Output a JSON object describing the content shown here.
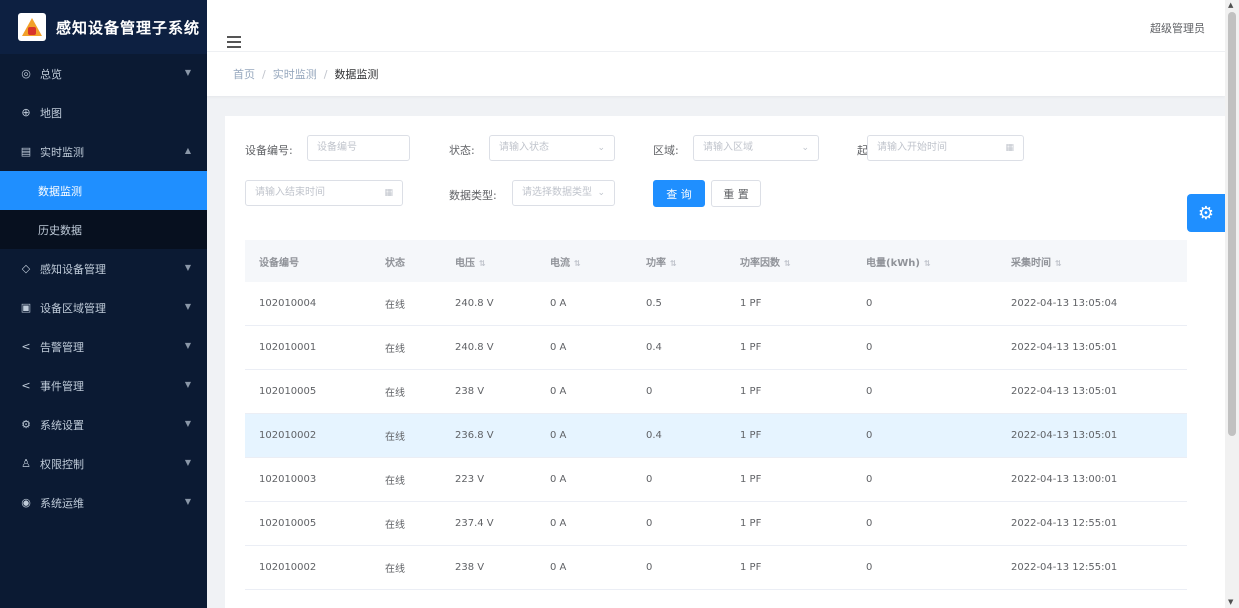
{
  "app": {
    "title": "感知设备管理子系统"
  },
  "sidebar": {
    "items": [
      {
        "label": "总览",
        "icon": "dashboard-icon",
        "has_children": true
      },
      {
        "label": "地图",
        "icon": "map-icon",
        "has_children": false
      },
      {
        "label": "实时监测",
        "icon": "monitor-icon",
        "has_children": true,
        "expanded": true,
        "children": [
          {
            "label": "数据监测",
            "active": true
          },
          {
            "label": "历史数据",
            "active": false
          }
        ]
      },
      {
        "label": "感知设备管理",
        "icon": "device-icon",
        "has_children": true
      },
      {
        "label": "设备区域管理",
        "icon": "region-icon",
        "has_children": true
      },
      {
        "label": "告警管理",
        "icon": "share-icon",
        "has_children": true
      },
      {
        "label": "事件管理",
        "icon": "share-icon",
        "has_children": true
      },
      {
        "label": "系统设置",
        "icon": "settings-icon",
        "has_children": true
      },
      {
        "label": "权限控制",
        "icon": "user-icon",
        "has_children": true
      },
      {
        "label": "系统运维",
        "icon": "tool-icon",
        "has_children": true
      }
    ]
  },
  "header": {
    "user": "超级管理员"
  },
  "breadcrumb": [
    "首页",
    "实时监测",
    "数据监测"
  ],
  "filters": {
    "device_no_label": "设备编号:",
    "device_no_placeholder": "设备编号",
    "status_label": "状态:",
    "status_placeholder": "请输入状态",
    "region_label": "区域:",
    "region_placeholder": "请输入区域",
    "start_placeholder": "请输入开始时间",
    "end_placeholder": "请输入结束时间",
    "type_label": "数据类型:",
    "type_placeholder": "请选择数据类型",
    "search_label": "查 询",
    "reset_label": "重 置"
  },
  "table": {
    "columns": [
      "设备编号",
      "状态",
      "电压",
      "电流",
      "功率",
      "功率因数",
      "电量(kWh)",
      "采集时间"
    ],
    "rows": [
      [
        "102010004",
        "在线",
        "240.8 V",
        "0 A",
        "0.5",
        "1 PF",
        "0",
        "2022-04-13 13:05:04"
      ],
      [
        "102010001",
        "在线",
        "240.8 V",
        "0 A",
        "0.4",
        "1 PF",
        "0",
        "2022-04-13 13:05:01"
      ],
      [
        "102010005",
        "在线",
        "238 V",
        "0 A",
        "0",
        "1 PF",
        "0",
        "2022-04-13 13:05:01"
      ],
      [
        "102010002",
        "在线",
        "236.8 V",
        "0 A",
        "0.4",
        "1 PF",
        "0",
        "2022-04-13 13:05:01"
      ],
      [
        "102010003",
        "在线",
        "223 V",
        "0 A",
        "0",
        "1 PF",
        "0",
        "2022-04-13 13:00:01"
      ],
      [
        "102010005",
        "在线",
        "237.4 V",
        "0 A",
        "0",
        "1 PF",
        "0",
        "2022-04-13 12:55:01"
      ],
      [
        "102010002",
        "在线",
        "238 V",
        "0 A",
        "0",
        "1 PF",
        "0",
        "2022-04-13 12:55:01"
      ]
    ],
    "highlight_row": 3
  },
  "colors": {
    "sidebar_bg": "#0b1a33",
    "accent": "#1f8fff",
    "highlight": "#e6f4ff"
  }
}
